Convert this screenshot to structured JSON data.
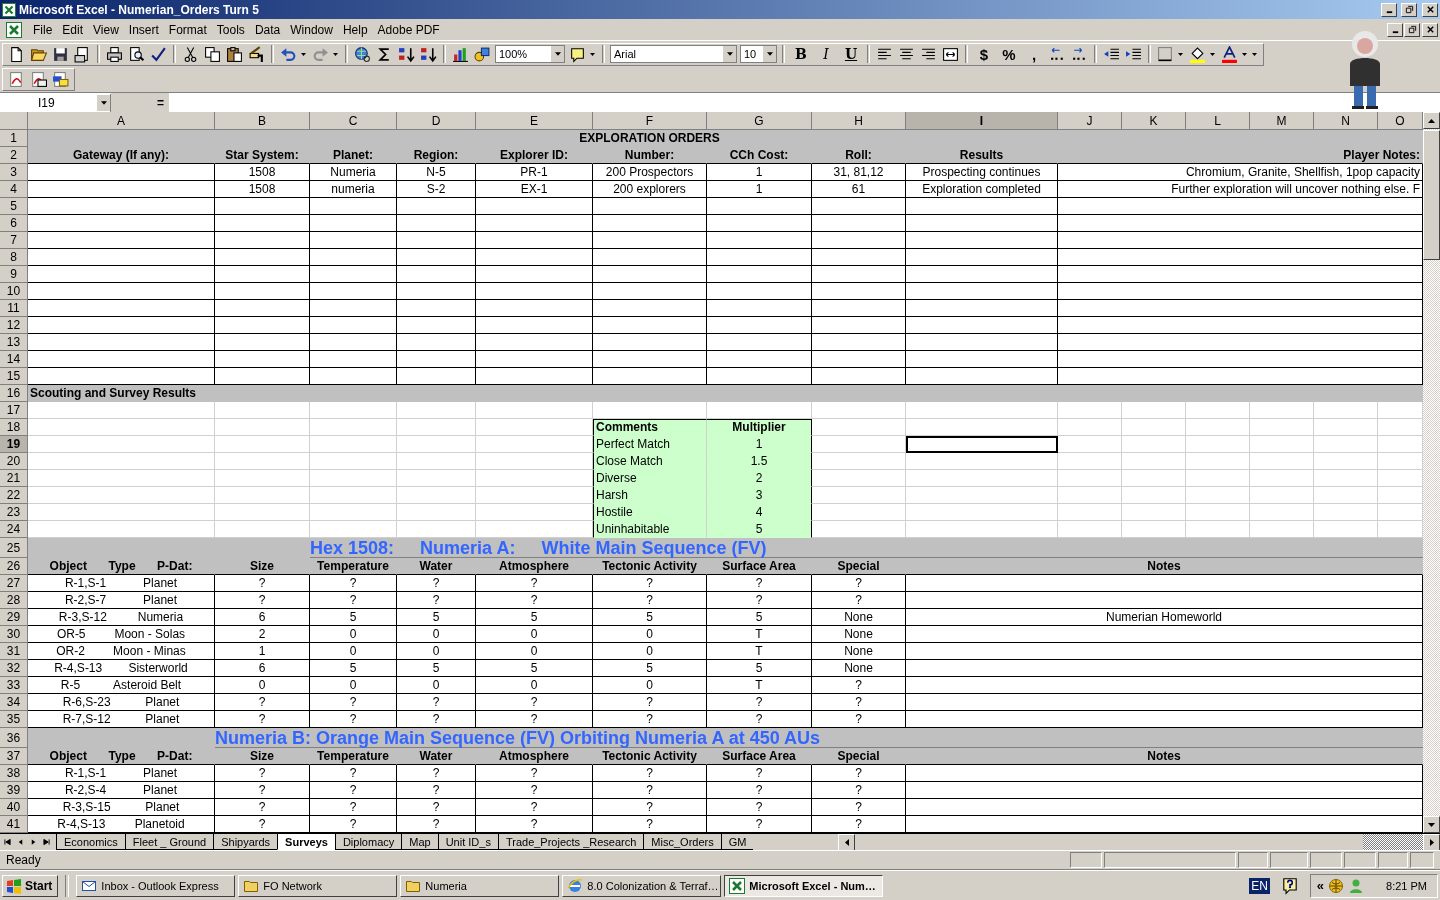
{
  "window": {
    "title": "Microsoft Excel - Numerian_Orders Turn 5"
  },
  "menu": [
    "File",
    "Edit",
    "View",
    "Insert",
    "Format",
    "Tools",
    "Data",
    "Window",
    "Help",
    "Adobe PDF"
  ],
  "toolbar": {
    "zoom": "100%",
    "font": "Arial",
    "size": "10",
    "style_buttons": [
      "B",
      "I",
      "U"
    ],
    "number_buttons": [
      "$",
      "%",
      ","
    ]
  },
  "formula_bar": {
    "name_box": "I19",
    "equals": "="
  },
  "columns": [
    {
      "label": "A",
      "selected": false
    },
    {
      "label": "B",
      "selected": false
    },
    {
      "label": "C",
      "selected": false
    },
    {
      "label": "D",
      "selected": false
    },
    {
      "label": "E",
      "selected": false
    },
    {
      "label": "F",
      "selected": false
    },
    {
      "label": "G",
      "selected": false
    },
    {
      "label": "H",
      "selected": false
    },
    {
      "label": "I",
      "selected": true
    },
    {
      "label": "J",
      "selected": false
    },
    {
      "label": "K",
      "selected": false
    },
    {
      "label": "L",
      "selected": false
    },
    {
      "label": "M",
      "selected": false
    },
    {
      "label": "N",
      "selected": false
    },
    {
      "label": "O",
      "selected": false
    }
  ],
  "rows": [
    {
      "number": "1",
      "kind": "title",
      "selected": false,
      "cells": {
        "heading": "EXPLORATION ORDERS"
      }
    },
    {
      "number": "2",
      "kind": "header",
      "selected": false,
      "cells": {
        "gateway": "Gateway (If any):",
        "star_system": "Star System:",
        "planet": "Planet:",
        "region": "Region:",
        "explorer_id": "Explorer ID:",
        "number": "Number:",
        "cch_cost": "CCh Cost:",
        "roll": "Roll:",
        "results": "Results",
        "player_notes": "Player Notes:"
      }
    },
    {
      "number": "3",
      "kind": "order",
      "selected": false,
      "cells": {
        "star_system": "1508",
        "planet": "Numeria",
        "region": "N-5",
        "explorer_id": "PR-1",
        "number": "200 Prospectors",
        "cch_cost": "1",
        "roll": "31, 81,12",
        "results": "Prospecting continues",
        "player_notes": "Chromium, Granite, Shellfish, 1pop capacity"
      }
    },
    {
      "number": "4",
      "kind": "order",
      "selected": false,
      "cells": {
        "star_system": "1508",
        "planet": "numeria",
        "region": "S-2",
        "explorer_id": "EX-1",
        "number": "200 explorers",
        "cch_cost": "1",
        "roll": "61",
        "results": "Exploration completed",
        "player_notes": "Further exploration will uncover nothing else. F"
      }
    },
    {
      "number": "5",
      "kind": "order",
      "selected": false
    },
    {
      "number": "6",
      "kind": "order",
      "selected": false
    },
    {
      "number": "7",
      "kind": "order",
      "selected": false
    },
    {
      "number": "8",
      "kind": "order",
      "selected": false
    },
    {
      "number": "9",
      "kind": "order",
      "selected": false
    },
    {
      "number": "10",
      "kind": "order",
      "selected": false
    },
    {
      "number": "11",
      "kind": "order",
      "selected": false
    },
    {
      "number": "12",
      "kind": "order",
      "selected": false
    },
    {
      "number": "13",
      "kind": "order",
      "selected": false
    },
    {
      "number": "14",
      "kind": "order",
      "selected": false
    },
    {
      "number": "15",
      "kind": "order",
      "selected": false
    },
    {
      "number": "16",
      "kind": "band",
      "selected": false,
      "cells": {
        "label": "Scouting and Survey Results"
      }
    },
    {
      "number": "17",
      "kind": "plain",
      "selected": false
    },
    {
      "number": "18",
      "kind": "multiplier-header",
      "selected": false,
      "cells": {
        "comments": "Comments",
        "multiplier": "Multiplier"
      }
    },
    {
      "number": "19",
      "kind": "multiplier",
      "selected": true,
      "cells": {
        "comments": "Perfect Match",
        "multiplier": "1"
      }
    },
    {
      "number": "20",
      "kind": "multiplier",
      "selected": false,
      "cells": {
        "comments": "Close Match",
        "multiplier": "1.5"
      }
    },
    {
      "number": "21",
      "kind": "multiplier",
      "selected": false,
      "cells": {
        "comments": "Diverse",
        "multiplier": "2"
      }
    },
    {
      "number": "22",
      "kind": "multiplier",
      "selected": false,
      "cells": {
        "comments": "Harsh",
        "multiplier": "3"
      }
    },
    {
      "number": "23",
      "kind": "multiplier",
      "selected": false,
      "cells": {
        "comments": "Hostile",
        "multiplier": "4"
      }
    },
    {
      "number": "24",
      "kind": "multiplier",
      "selected": false,
      "cells": {
        "comments": "Uninhabitable",
        "multiplier": "5"
      }
    },
    {
      "number": "25",
      "kind": "hex-title",
      "selected": false,
      "cells": {
        "hex": "Hex 1508:",
        "star": "Numeria A:",
        "class": "White Main Sequence (FV)"
      }
    },
    {
      "number": "26",
      "kind": "planet-header",
      "selected": false,
      "cells": {
        "object": "Object",
        "type": "Type",
        "p_dat": "P-Dat:",
        "size": "Size",
        "temperature": "Temperature",
        "water": "Water",
        "atmosphere": "Atmosphere",
        "tectonic": "Tectonic Activity",
        "surface": "Surface Area",
        "special": "Special",
        "notes": "Notes"
      }
    },
    {
      "number": "27",
      "kind": "planet",
      "selected": false,
      "cells": {
        "object": "R-1,S-1",
        "type": "Planet",
        "size": "?",
        "temperature": "?",
        "water": "?",
        "atmosphere": "?",
        "tectonic": "?",
        "surface": "?",
        "special": "?"
      }
    },
    {
      "number": "28",
      "kind": "planet",
      "selected": false,
      "cells": {
        "object": "R-2,S-7",
        "type": "Planet",
        "size": "?",
        "temperature": "?",
        "water": "?",
        "atmosphere": "?",
        "tectonic": "?",
        "surface": "?",
        "special": "?"
      }
    },
    {
      "number": "29",
      "kind": "planet",
      "selected": false,
      "cells": {
        "object": "R-3,S-12",
        "type": "Numeria",
        "size": "6",
        "temperature": "5",
        "water": "5",
        "atmosphere": "5",
        "tectonic": "5",
        "surface": "5",
        "special": "None",
        "notes": "Numerian Homeworld"
      }
    },
    {
      "number": "30",
      "kind": "planet",
      "selected": false,
      "cells": {
        "object": "OR-5",
        "type": "Moon - Solas",
        "size": "2",
        "temperature": "0",
        "water": "0",
        "atmosphere": "0",
        "tectonic": "0",
        "surface": "T",
        "special": "None"
      }
    },
    {
      "number": "31",
      "kind": "planet",
      "selected": false,
      "cells": {
        "object": "OR-2",
        "type": "Moon - Minas",
        "size": "1",
        "temperature": "0",
        "water": "0",
        "atmosphere": "0",
        "tectonic": "0",
        "surface": "T",
        "special": "None"
      }
    },
    {
      "number": "32",
      "kind": "planet",
      "selected": false,
      "cells": {
        "object": "R-4,S-13",
        "type": "Sisterworld",
        "size": "6",
        "temperature": "5",
        "water": "5",
        "atmosphere": "5",
        "tectonic": "5",
        "surface": "5",
        "special": "None"
      }
    },
    {
      "number": "33",
      "kind": "planet",
      "selected": false,
      "cells": {
        "object": "R-5",
        "type": "Asteroid Belt",
        "size": "0",
        "temperature": "0",
        "water": "0",
        "atmosphere": "0",
        "tectonic": "0",
        "surface": "T",
        "special": "?"
      }
    },
    {
      "number": "34",
      "kind": "planet",
      "selected": false,
      "cells": {
        "object": "R-6,S-23",
        "type": "Planet",
        "size": "?",
        "temperature": "?",
        "water": "?",
        "atmosphere": "?",
        "tectonic": "?",
        "surface": "?",
        "special": "?"
      }
    },
    {
      "number": "35",
      "kind": "planet",
      "selected": false,
      "cells": {
        "object": "R-7,S-12",
        "type": "Planet",
        "size": "?",
        "temperature": "?",
        "water": "?",
        "atmosphere": "?",
        "tectonic": "?",
        "surface": "?",
        "special": "?"
      }
    },
    {
      "number": "36",
      "kind": "hex-title",
      "selected": false,
      "cells": {
        "caption": "Numeria B: Orange Main Sequence (FV) Orbiting Numeria A at 450 AUs"
      }
    },
    {
      "number": "37",
      "kind": "planet-header",
      "selected": false,
      "cells": {
        "object": "Object",
        "type": "Type",
        "p_dat": "P-Dat:",
        "size": "Size",
        "temperature": "Temperature",
        "water": "Water",
        "atmosphere": "Atmosphere",
        "tectonic": "Tectonic Activity",
        "surface": "Surface Area",
        "special": "Special",
        "notes": "Notes"
      }
    },
    {
      "number": "38",
      "kind": "planet",
      "selected": false,
      "cells": {
        "object": "R-1,S-1",
        "type": "Planet",
        "size": "?",
        "temperature": "?",
        "water": "?",
        "atmosphere": "?",
        "tectonic": "?",
        "surface": "?",
        "special": "?"
      }
    },
    {
      "number": "39",
      "kind": "planet",
      "selected": false,
      "cells": {
        "object": "R-2,S-4",
        "type": "Planet",
        "size": "?",
        "temperature": "?",
        "water": "?",
        "atmosphere": "?",
        "tectonic": "?",
        "surface": "?",
        "special": "?"
      }
    },
    {
      "number": "40",
      "kind": "planet",
      "selected": false,
      "cells": {
        "object": "R-3,S-15",
        "type": "Planet",
        "size": "?",
        "temperature": "?",
        "water": "?",
        "atmosphere": "?",
        "tectonic": "?",
        "surface": "?",
        "special": "?"
      }
    },
    {
      "number": "41",
      "kind": "planet",
      "selected": false,
      "cells": {
        "object": "R-4,S-13",
        "type": "Planetoid",
        "size": "?",
        "temperature": "?",
        "water": "?",
        "atmosphere": "?",
        "tectonic": "?",
        "surface": "?",
        "special": "?"
      }
    }
  ],
  "sheet_tabs": [
    {
      "label": "Economics",
      "selected": false
    },
    {
      "label": "Fleet _ Ground",
      "selected": false
    },
    {
      "label": "Shipyards",
      "selected": false
    },
    {
      "label": "Surveys",
      "selected": true
    },
    {
      "label": "Diplomacy",
      "selected": false
    },
    {
      "label": "Map",
      "selected": false
    },
    {
      "label": "Unit ID_s",
      "selected": false
    },
    {
      "label": "Trade_Projects _Research",
      "selected": false
    },
    {
      "label": "Misc_Orders",
      "selected": false
    },
    {
      "label": "GM",
      "selected": false
    }
  ],
  "status_bar": {
    "text": "Ready"
  },
  "taskbar": {
    "start": "Start",
    "items": [
      {
        "label": "Inbox - Outlook Express",
        "kind": "mail",
        "selected": false
      },
      {
        "label": "FO Network",
        "kind": "folder",
        "selected": false
      },
      {
        "label": "Numeria",
        "kind": "folder",
        "selected": false
      },
      {
        "label": "8.0 Colonization & Terraf…",
        "kind": "browser",
        "selected": false
      },
      {
        "label": "Microsoft Excel - Num…",
        "kind": "spreadsheet",
        "selected": true
      }
    ],
    "tray": {
      "language": "EN",
      "expand": "«",
      "clock": "8:21 PM"
    }
  }
}
